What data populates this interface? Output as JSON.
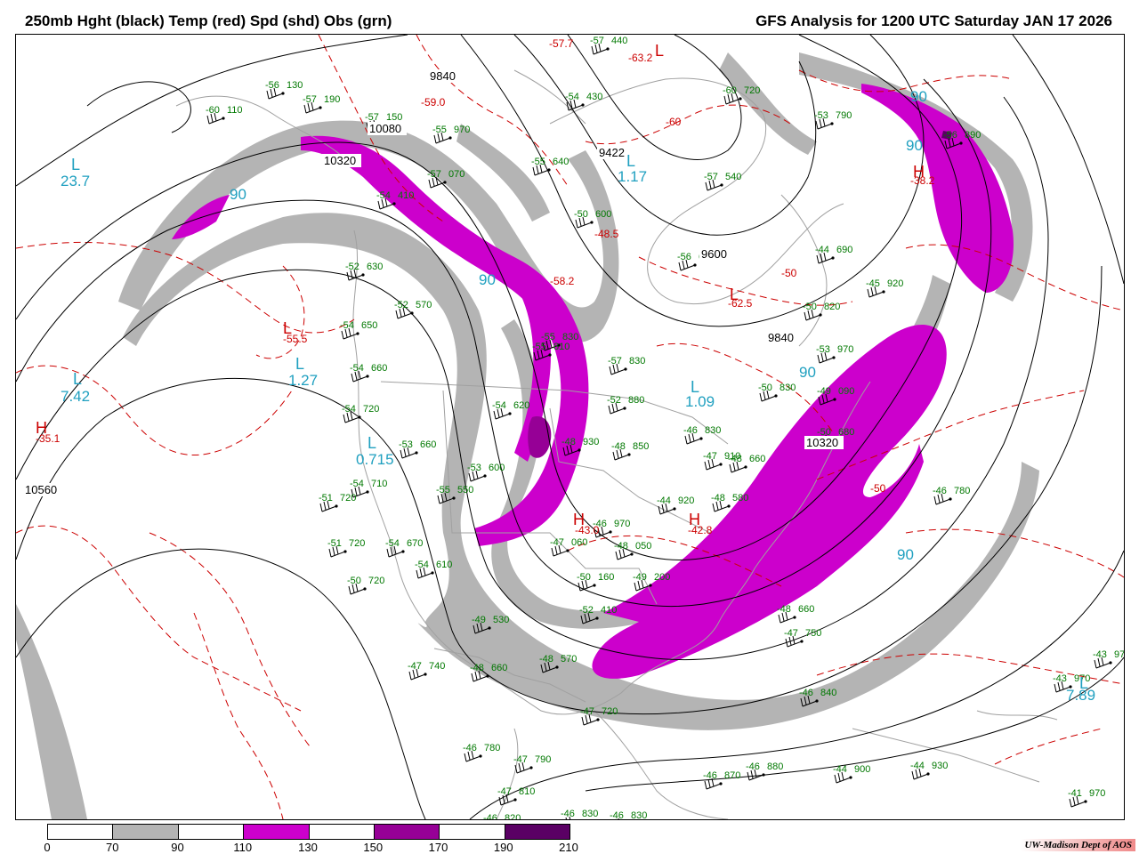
{
  "header": {
    "left_title": "250mb Hght (black) Temp (red) Spd (shd) Obs (grn)",
    "right_title": "GFS Analysis for 1200 UTC Saturday  JAN 17 2026"
  },
  "colors": {
    "height_contour": "#000000",
    "temperature_contour": "#cc0000",
    "speed_70_90": "#b4b4b4",
    "speed_110_130": "#cc00cc",
    "speed_130_150": "#d21ed2",
    "speed_150_170": "#9600a0",
    "speed_190_210": "#5a0064",
    "observations": "#007800",
    "speed_labels": "#20a0c0",
    "geography": "#a0a0a0"
  },
  "colorbar": {
    "ticks": [
      "0",
      "70",
      "90",
      "110",
      "130",
      "150",
      "170",
      "190",
      "210"
    ],
    "segments": [
      "#ffffff",
      "#b4b4b4",
      "#ffffff",
      "#cc00cc",
      "#ffffff",
      "#960096",
      "#ffffff",
      "#5a0064"
    ]
  },
  "credit": "UW-Madison   Dept of AOS",
  "height_labels": [
    "9840",
    "10080",
    "10320",
    "9422",
    "9600",
    "9840",
    "10560",
    "10320"
  ],
  "temperature_labels": [
    "-59.0",
    "-57.7",
    "-63.2",
    "-60",
    "-48.5",
    "-58.2",
    "-50",
    "-62.5",
    "-55.5",
    "-35.1",
    "-38.2",
    "-43.0",
    "-42.8",
    "-50"
  ],
  "center_markers": [
    "L",
    "L",
    "L",
    "L",
    "L",
    "L",
    "L",
    "H",
    "H",
    "H",
    "H",
    "L",
    "L",
    "L"
  ],
  "speed_labels": [
    "23.7",
    "1.17",
    "7.42",
    "1.27",
    "0.715",
    "1.09",
    "7.89",
    "90",
    "90",
    "90",
    "90",
    "90",
    "90"
  ],
  "observations": [
    "-56 130",
    "-60 110",
    "-57 190",
    "-57 150",
    "-55 970",
    "-57 070",
    "-54 410",
    "-52 630",
    "-52 570",
    "-54 650",
    "-54 660",
    "-54 720",
    "-53 660",
    "-54 710",
    "-51 720",
    "-51 720",
    "-54 670",
    "-54 610",
    "-50 720",
    "-55 550",
    "-53 600",
    "-54 620",
    "-55 830",
    "-52 880",
    "-48 930",
    "-48 850",
    "-57 830",
    "-55 640",
    "-54 430",
    "-57 540",
    "-56 600",
    "-50 600",
    "-60 720",
    "-53 790",
    "-44 690",
    "-45 920",
    "-50 820",
    "-53 970",
    "-50 830",
    "-46 830",
    "-47 910",
    "-44 920",
    "-48 580",
    "-46 970",
    "-47 060",
    "-48 050",
    "-49 200",
    "-50 160",
    "-52 410",
    "-49 530",
    "-48 570",
    "-47 740",
    "-48 660",
    "-47 720",
    "-48 660",
    "-47 750",
    "-46 840",
    "-46 780",
    "-47 790",
    "-47 810",
    "-46 820",
    "-46 830",
    "-46 830",
    "-46 870",
    "-46 880",
    "-44 900",
    "-44 930",
    "-41 970",
    "-43 970",
    "-43 970",
    "-46 780",
    "-49 090",
    "-50 680",
    "-48 660",
    "-55 810",
    "-56 890",
    "-57 440"
  ]
}
